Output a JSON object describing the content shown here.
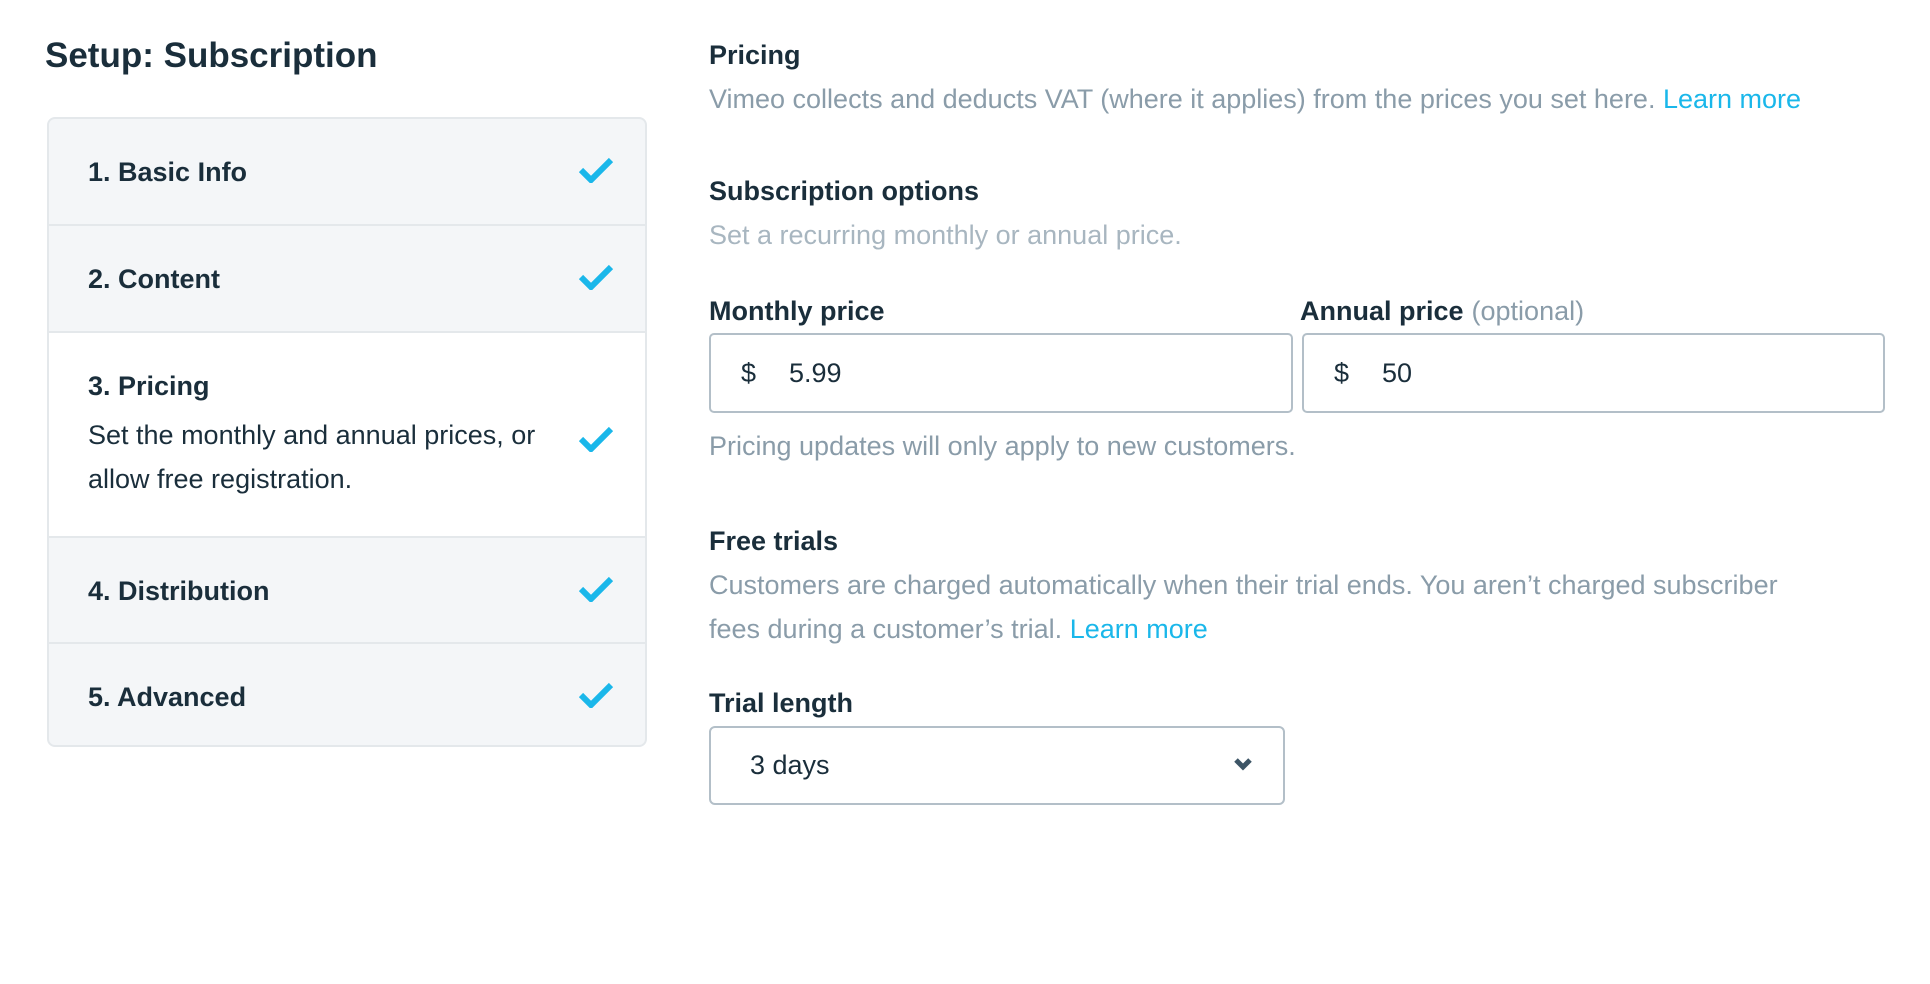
{
  "page": {
    "title": "Setup: Subscription"
  },
  "steps": [
    {
      "label": "1. Basic Info",
      "completed": true,
      "active": false,
      "icon": "checkmark-icon"
    },
    {
      "label": "2. Content",
      "completed": true,
      "active": false,
      "icon": "checkmark-icon"
    },
    {
      "label": "3. Pricing",
      "description": "Set the monthly and annual prices, or allow free registration.",
      "completed": true,
      "active": true,
      "icon": "checkmark-icon"
    },
    {
      "label": "4. Distribution",
      "completed": true,
      "active": false,
      "icon": "checkmark-icon"
    },
    {
      "label": "5. Advanced",
      "completed": true,
      "active": false,
      "icon": "checkmark-icon"
    }
  ],
  "pricing": {
    "heading": "Pricing",
    "description": "Vimeo collects and deducts VAT (where it applies) from the prices you set here.",
    "learn_more": "Learn more"
  },
  "subscription_options": {
    "heading": "Subscription options",
    "description": "Set a recurring monthly or annual price.",
    "monthly": {
      "label": "Monthly price",
      "currency": "$",
      "value": "5.99"
    },
    "annual": {
      "label": "Annual price",
      "optional": "(optional)",
      "currency": "$",
      "value": "50"
    },
    "note": "Pricing updates will only apply to new customers."
  },
  "free_trials": {
    "heading": "Free trials",
    "description_line1": "Customers are charged automatically when their trial ends. You aren’t charged subscriber",
    "description_line2": "fees during a customer’s trial.",
    "learn_more": "Learn more",
    "trial_length_label": "Trial length",
    "trial_length_value": "3 days",
    "chevron_icon": "chevron-down-icon"
  },
  "colors": {
    "accent": "#1ab7ea",
    "text_dark": "#1a2e3b",
    "text_muted": "#8a9ca9",
    "text_light": "#a8b6c0",
    "border": "#b3bfc8",
    "panel_bg": "#f4f6f8"
  }
}
